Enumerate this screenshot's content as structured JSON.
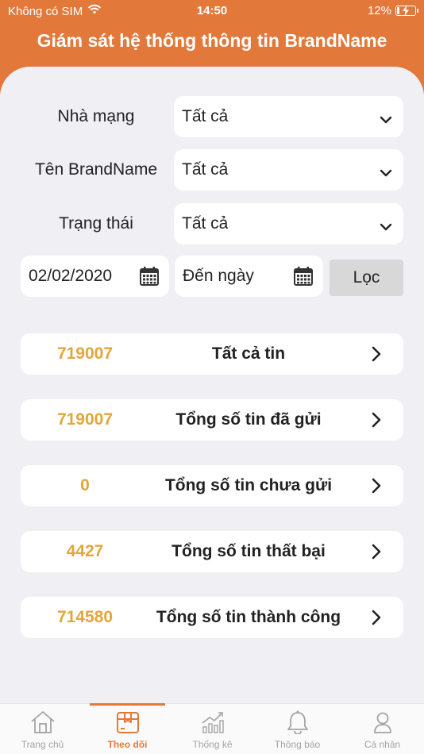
{
  "status_bar": {
    "carrier": "Không có SIM",
    "time": "14:50",
    "battery": "12%",
    "battery_level": 0.12
  },
  "header": {
    "title": "Giám sát hệ thống thông tin BrandName"
  },
  "filters": {
    "network": {
      "label": "Nhà mạng",
      "value": "Tất cả"
    },
    "brandname": {
      "label": "Tên BrandName",
      "value": "Tất cả"
    },
    "status": {
      "label": "Trạng thái",
      "value": "Tất cả"
    },
    "date_from": {
      "value": "02/02/2020"
    },
    "date_to": {
      "placeholder": "Đến ngày"
    },
    "filter_button": "Lọc"
  },
  "stats": [
    {
      "value": "719007",
      "label": "Tất cả tin"
    },
    {
      "value": "719007",
      "label": "Tổng số tin đã gửi"
    },
    {
      "value": "0",
      "label": "Tổng số tin chưa gửi"
    },
    {
      "value": "4427",
      "label": "Tổng số tin thất bại"
    },
    {
      "value": "714580",
      "label": "Tổng số tin thành công"
    }
  ],
  "tabbar": {
    "active_index": 1,
    "tabs": [
      {
        "label": "Trang chủ",
        "icon": "home-icon"
      },
      {
        "label": "Theo dõi",
        "icon": "box-icon"
      },
      {
        "label": "Thống kê",
        "icon": "chart-icon"
      },
      {
        "label": "Thông báo",
        "icon": "bell-icon"
      },
      {
        "label": "Cá nhân",
        "icon": "user-icon"
      }
    ]
  },
  "colors": {
    "brand": "#e2793b",
    "accent_number": "#e3a63a",
    "background": "#f0f0f4"
  }
}
